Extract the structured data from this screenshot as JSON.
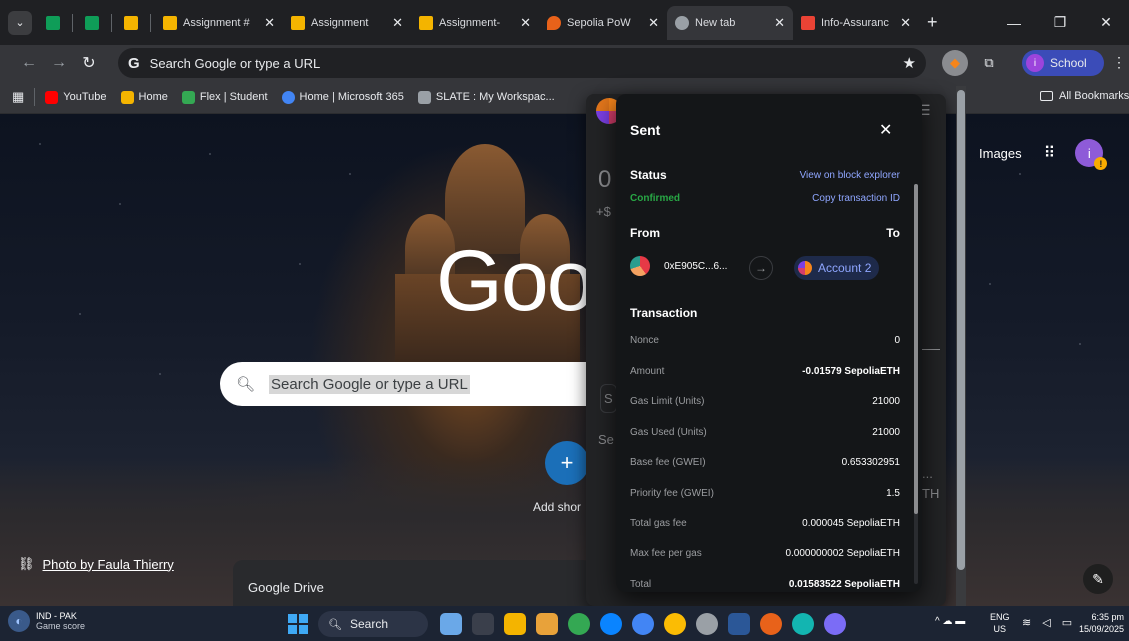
{
  "tabs": [
    {
      "title": "Assignment #",
      "favicon_color": "#f4b400"
    },
    {
      "title": "Assignment",
      "favicon_color": "#f4b400"
    },
    {
      "title": "Assignment-",
      "favicon_color": "#f4b400"
    },
    {
      "title": "Sepolia PoW",
      "favicon_color": "#e8621a"
    },
    {
      "title": "New tab",
      "favicon_color": "#9aa0a6",
      "active": true
    },
    {
      "title": "Info-Assuranc",
      "favicon_color": "#ea4335"
    }
  ],
  "toolbar": {
    "omnibox_text": "Search Google or type a URL",
    "profile_name": "School",
    "profile_initial": "i"
  },
  "bookmarks": [
    {
      "label": "YouTube",
      "color": "#ff0000"
    },
    {
      "label": "Home",
      "color": "#f4b400"
    },
    {
      "label": "Flex | Student",
      "color": "#34a853"
    },
    {
      "label": "Home | Microsoft 365",
      "color": "#4285f4"
    },
    {
      "label": "SLATE : My Workspac...",
      "color": "#9aa0a6"
    }
  ],
  "all_bookmarks": "All Bookmarks",
  "ntp": {
    "logo_text": "Goo",
    "search_placeholder": "Search Google or type a URL",
    "add_shortcut_label": "Add shor",
    "images_link": "Images",
    "account_initial": "i",
    "photo_credit": "Photo by Faula Thierry",
    "drive_card": "Google Drive"
  },
  "metamask_bg": {
    "balance_frag": "0",
    "fiat_frag": "+$",
    "search_frag": "S",
    "search2_frag": "Se",
    "eth_frag": "TH",
    "dots": "..."
  },
  "modal": {
    "title": "Sent",
    "status_label": "Status",
    "status_value": "Confirmed",
    "explorer_link": "View on block explorer",
    "copy_link": "Copy transaction ID",
    "from_label": "From",
    "to_label": "To",
    "from_address": "0xE905C...6...",
    "to_account": "Account 2",
    "transaction_label": "Transaction",
    "fields": [
      {
        "label": "Nonce",
        "value": "0",
        "bold": false
      },
      {
        "label": "Amount",
        "value": "-0.01579 SepoliaETH",
        "bold": true
      },
      {
        "label": "Gas Limit (Units)",
        "value": "21000",
        "bold": false
      },
      {
        "label": "Gas Used (Units)",
        "value": "21000",
        "bold": false
      },
      {
        "label": "Base fee (GWEI)",
        "value": "0.653302951",
        "bold": false
      },
      {
        "label": "Priority fee (GWEI)",
        "value": "1.5",
        "bold": false
      },
      {
        "label": "Total gas fee",
        "value": "0.000045 SepoliaETH",
        "bold": false
      },
      {
        "label": "Max fee per gas",
        "value": "0.000000002 SepoliaETH",
        "bold": false
      },
      {
        "label": "Total",
        "value": "0.01583522 SepoliaETH",
        "bold": true
      }
    ]
  },
  "taskbar": {
    "weather_line1": "IND - PAK",
    "weather_line2": "Game score",
    "search_label": "Search",
    "lang_line1": "ENG",
    "lang_line2": "US",
    "time": "6:35 pm",
    "date": "15/09/2025",
    "app_colors": [
      "#6aa8e8",
      "#3a3f4b",
      "#f4b400",
      "#e8a23a",
      "#34a853",
      "#0a84ff",
      "#4285f4",
      "#fbbc04",
      "#9aa0a6",
      "#2b5797",
      "#e8621a",
      "#13b5b1",
      "#7b6cf6"
    ]
  }
}
